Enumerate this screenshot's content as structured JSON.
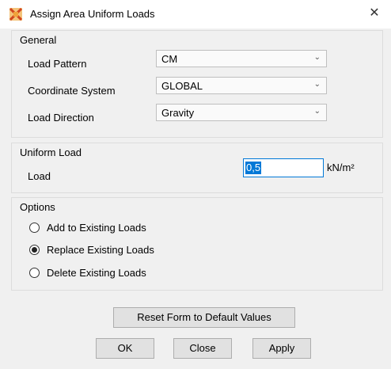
{
  "window": {
    "title": "Assign Area Uniform Loads",
    "close_glyph": "✕"
  },
  "general": {
    "title": "General",
    "load_pattern": {
      "label": "Load Pattern",
      "value": "CM"
    },
    "coordinate_system": {
      "label": "Coordinate System",
      "value": "GLOBAL"
    },
    "load_direction": {
      "label": "Load Direction",
      "value": "Gravity"
    }
  },
  "uniform_load": {
    "title": "Uniform Load",
    "load_label": "Load",
    "load_value": "0,5",
    "unit": "kN/m²"
  },
  "options": {
    "title": "Options",
    "radios": [
      {
        "label": "Add to Existing Loads",
        "checked": false
      },
      {
        "label": "Replace Existing Loads",
        "checked": true
      },
      {
        "label": "Delete Existing Loads",
        "checked": false
      }
    ]
  },
  "buttons": {
    "reset": "Reset Form to Default Values",
    "ok": "OK",
    "close": "Close",
    "apply": "Apply"
  },
  "icons": {
    "app": "etabs-logo-icon",
    "dropdown": "chevron-down-icon",
    "close": "close-icon"
  },
  "colors": {
    "accent": "#0078d7",
    "dialog_bg": "#f0f0f0"
  }
}
